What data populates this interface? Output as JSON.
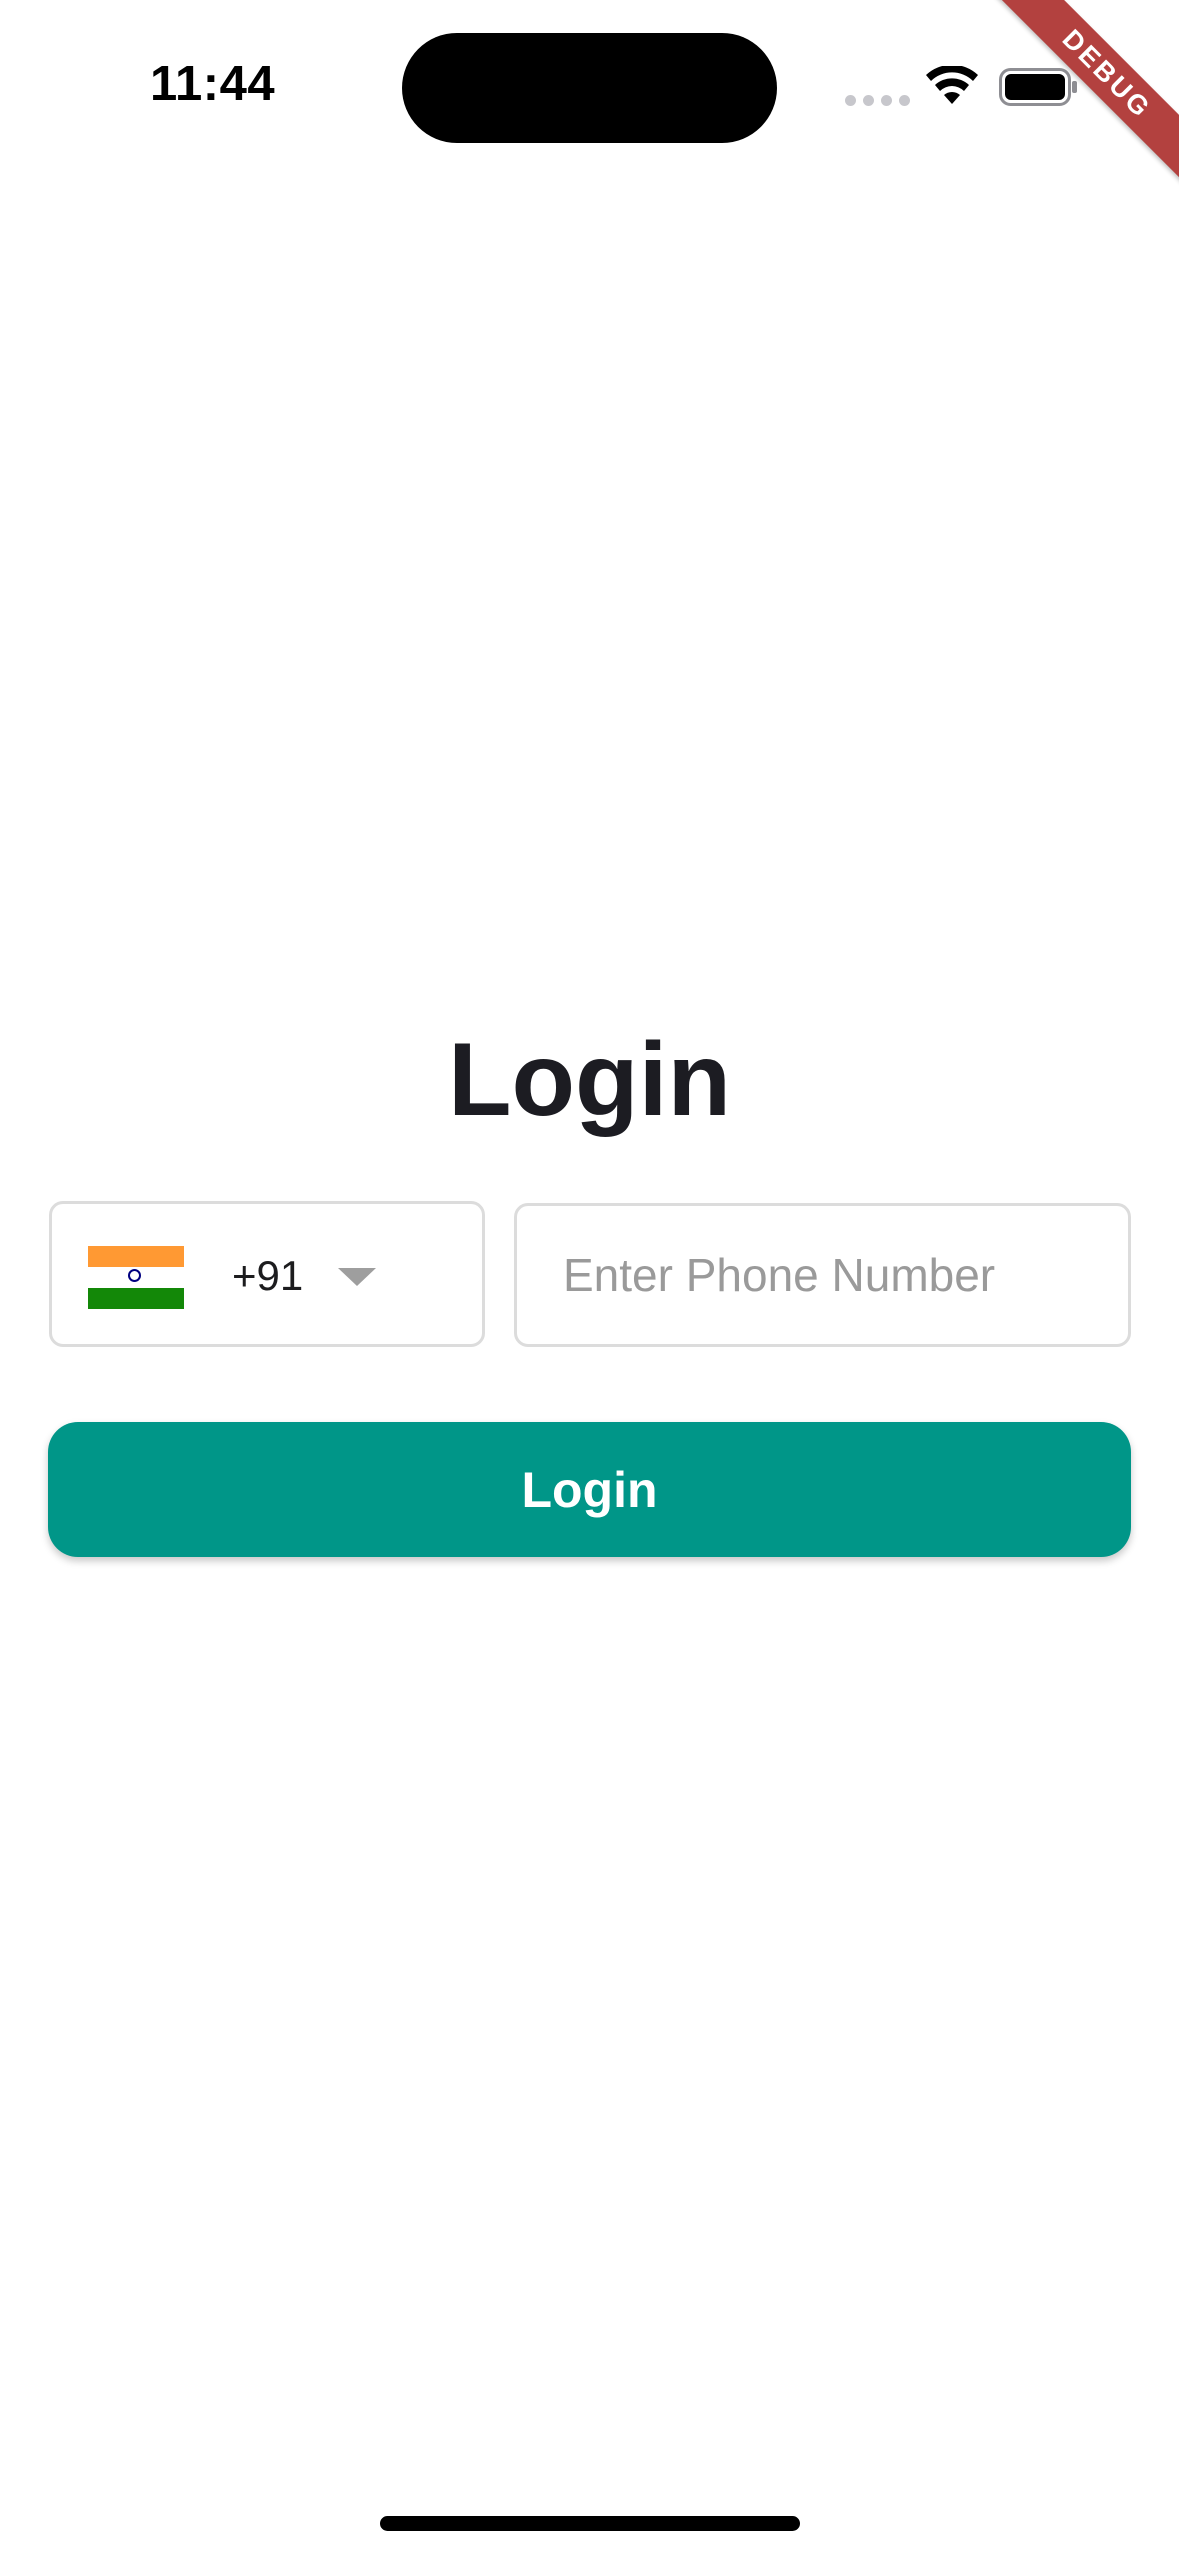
{
  "status_bar": {
    "time": "11:44"
  },
  "debug_banner": {
    "label": "DEBUG",
    "color": "#b3413f"
  },
  "login": {
    "title": "Login",
    "country": {
      "flag": "india-flag-icon",
      "dial_code": "+91"
    },
    "phone": {
      "value": "",
      "placeholder": "Enter Phone Number"
    },
    "button_label": "Login",
    "accent_color": "#009688"
  }
}
